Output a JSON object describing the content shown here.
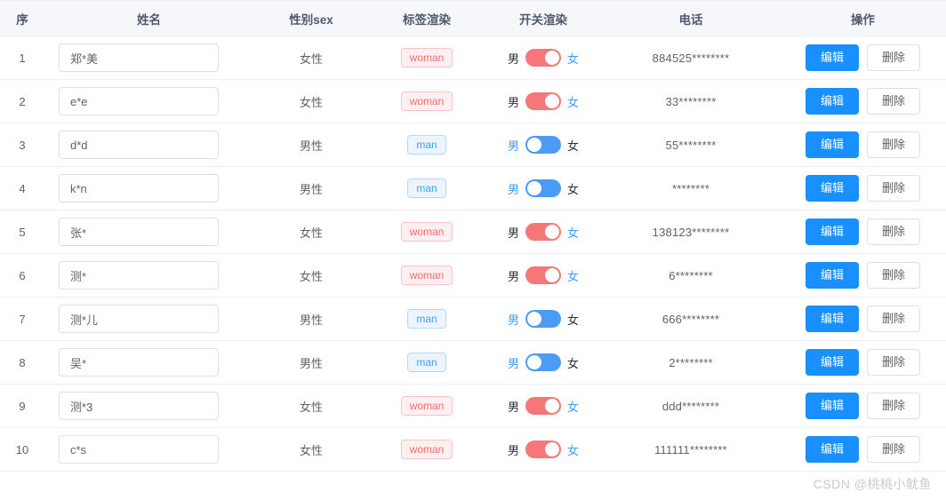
{
  "table": {
    "columns": [
      {
        "key": "index",
        "label": "序"
      },
      {
        "key": "name",
        "label": "姓名"
      },
      {
        "key": "sex",
        "label": "性别sex"
      },
      {
        "key": "tag",
        "label": "标签渲染"
      },
      {
        "key": "switch",
        "label": "开关渲染"
      },
      {
        "key": "phone",
        "label": "电话"
      },
      {
        "key": "action",
        "label": "操作"
      }
    ],
    "switch_labels": {
      "male": "男",
      "female": "女"
    },
    "actions": {
      "edit": "编辑",
      "delete": "删除"
    },
    "rows": [
      {
        "index": "1",
        "name": "郑*美",
        "sex": "女性",
        "tag": "woman",
        "gender": "female",
        "phone": "884525********"
      },
      {
        "index": "2",
        "name": "e*e",
        "sex": "女性",
        "tag": "woman",
        "gender": "female",
        "phone": "33********"
      },
      {
        "index": "3",
        "name": "d*d",
        "sex": "男性",
        "tag": "man",
        "gender": "male",
        "phone": "55********"
      },
      {
        "index": "4",
        "name": "k*n",
        "sex": "男性",
        "tag": "man",
        "gender": "male",
        "phone": "********"
      },
      {
        "index": "5",
        "name": "张*",
        "sex": "女性",
        "tag": "woman",
        "gender": "female",
        "phone": "138123********"
      },
      {
        "index": "6",
        "name": "测*",
        "sex": "女性",
        "tag": "woman",
        "gender": "female",
        "phone": "6********"
      },
      {
        "index": "7",
        "name": "测*儿",
        "sex": "男性",
        "tag": "man",
        "gender": "male",
        "phone": "666********"
      },
      {
        "index": "8",
        "name": "吴*",
        "sex": "男性",
        "tag": "man",
        "gender": "male",
        "phone": "2********"
      },
      {
        "index": "9",
        "name": "测*3",
        "sex": "女性",
        "tag": "woman",
        "gender": "female",
        "phone": "ddd********"
      },
      {
        "index": "10",
        "name": "c*s",
        "sex": "女性",
        "tag": "woman",
        "gender": "female",
        "phone": "111111********"
      }
    ]
  },
  "watermark": {
    "text": "CSDN @桃桃小鱿鱼"
  },
  "colors": {
    "primary": "#409eff",
    "edit_button": "#1890ff",
    "danger": "#f56c6c",
    "switch_female": "#f57777",
    "switch_male": "#4c9bf5",
    "header_bg": "#f5f7fa",
    "border": "#ebeef5"
  }
}
